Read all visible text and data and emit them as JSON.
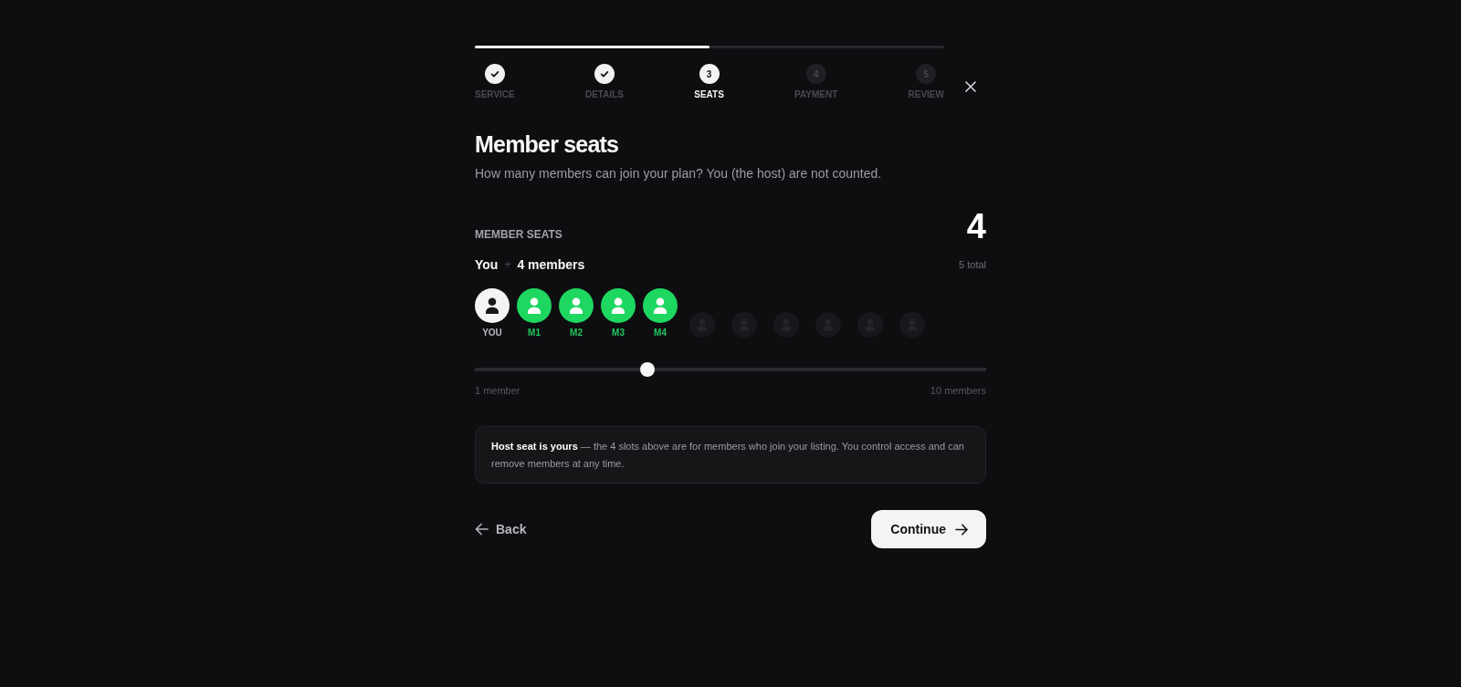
{
  "progress": {
    "level": 0.5
  },
  "steps": [
    {
      "label": "SERVICE",
      "done": true,
      "current": false
    },
    {
      "label": "DETAILS",
      "done": true,
      "current": false
    },
    {
      "label": "SEATS",
      "number": "3",
      "done": false,
      "current": true
    },
    {
      "label": "PAYMENT",
      "number": "4",
      "done": false,
      "current": false
    },
    {
      "label": "REVIEW",
      "number": "5",
      "done": false,
      "current": false
    }
  ],
  "heading": "Member seats",
  "subtitle": "How many members can join your plan? You (the host) are not counted.",
  "seats_panel": {
    "label": "MEMBER SEATS",
    "count": "4",
    "summary": {
      "host": "You",
      "plus": "+",
      "members": "4 members"
    },
    "total": "5 total"
  },
  "seats": [
    {
      "kind": "host",
      "label": "YOU"
    },
    {
      "kind": "member",
      "label": "M1"
    },
    {
      "kind": "member",
      "label": "M2"
    },
    {
      "kind": "member",
      "label": "M3"
    },
    {
      "kind": "member",
      "label": "M4"
    },
    {
      "kind": "empty"
    },
    {
      "kind": "empty"
    },
    {
      "kind": "empty"
    },
    {
      "kind": "empty"
    },
    {
      "kind": "empty"
    },
    {
      "kind": "empty"
    }
  ],
  "slider": {
    "level": 0.333,
    "min_label": "1 member",
    "max_label": "10 members"
  },
  "note": "**Host seat is yours** — the 4 slots above are for members who join your listing. You control access and can remove members at any time.",
  "actions": {
    "back": "Back",
    "continue": "Continue"
  }
}
